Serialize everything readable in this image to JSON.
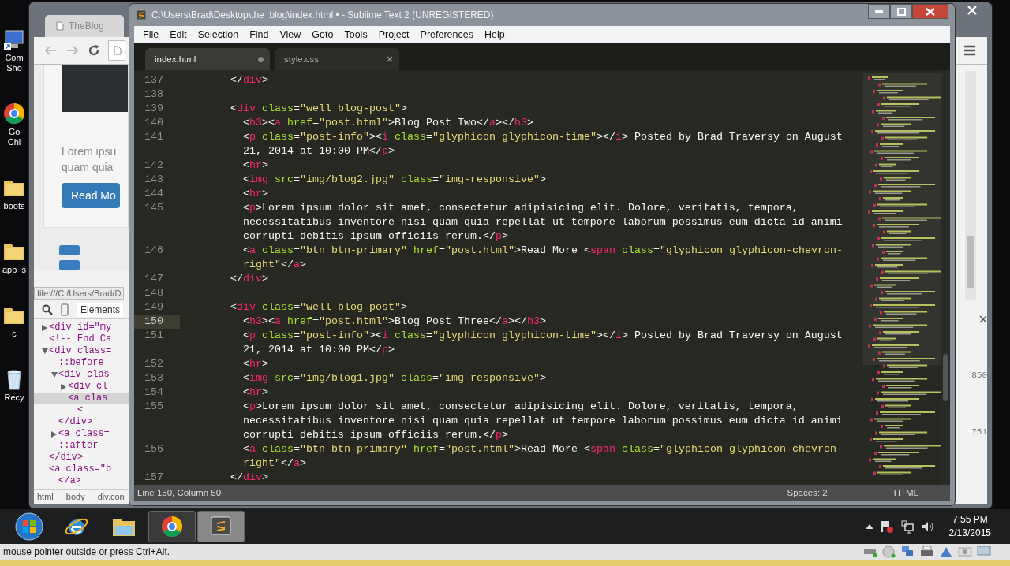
{
  "desktop_icons": [
    {
      "kind": "computer",
      "label": "Com Sho"
    },
    {
      "kind": "chrome",
      "label": "Go Chi"
    },
    {
      "kind": "folder",
      "label": "boots"
    },
    {
      "kind": "folder",
      "label": "app_s"
    },
    {
      "kind": "folder",
      "label": "c"
    },
    {
      "kind": "recycle",
      "label": "Recy"
    }
  ],
  "browser": {
    "tab": "TheBlog",
    "page": {
      "text_lines": [
        "Lorem ipsu",
        "quam quia"
      ],
      "button": "Read Mo"
    },
    "status_url": "file:///C:/Users/Brad/D",
    "devtools": {
      "tabs": [
        {
          "label": "Elements",
          "selected": true
        }
      ],
      "tree": [
        {
          "text": "<div id=\"my",
          "expanded": false,
          "selected": false
        },
        {
          "text": "<!-- End Ca",
          "selected": false
        },
        {
          "text": "<div class=",
          "expanded": true,
          "selected": false,
          "children": [
            {
              "text": "::before",
              "selected": false
            },
            {
              "text": "<div clas",
              "expanded": true,
              "selected": false,
              "children": [
                {
                  "text": "<div cl",
                  "expanded": false,
                  "selected": false
                },
                {
                  "text": "<a clas",
                  "selected": true,
                  "children": [
                    {
                      "text": "<",
                      "selected": false
                    }
                  ]
                }
              ]
            },
            {
              "text": "</div>",
              "selected": false
            },
            {
              "text": "<a class=",
              "expanded": false,
              "selected": false
            },
            {
              "text": "::after",
              "selected": false
            }
          ]
        },
        {
          "text": "</div>",
          "selected": false
        },
        {
          "text": "<a class=\"b",
          "selected": false,
          "children": [
            {
              "text": "</a>",
              "selected": false
            }
          ]
        }
      ],
      "breadcrumbs": [
        "html",
        "body",
        "div.con"
      ],
      "side_values": [
        "850",
        "751"
      ]
    }
  },
  "editor": {
    "title": "C:\\Users\\Brad\\Desktop\\the_blog\\index.html • - Sublime Text 2 (UNREGISTERED)",
    "menu": [
      "File",
      "Edit",
      "Selection",
      "Find",
      "View",
      "Goto",
      "Tools",
      "Project",
      "Preferences",
      "Help"
    ],
    "tabs": [
      {
        "label": "index.html",
        "selected": true,
        "modified": true
      },
      {
        "label": "style.css",
        "selected": false,
        "modified": false
      }
    ],
    "lines": [
      {
        "number": "137",
        "current": false,
        "tokens": [
          {
            "kind": "p",
            "text": "        </"
          },
          {
            "kind": "tag",
            "text": "div"
          },
          {
            "kind": "p",
            "text": ">"
          }
        ]
      },
      {
        "number": "138",
        "current": false
      },
      {
        "number": "139",
        "current": false,
        "tokens": [
          {
            "kind": "p",
            "text": "        <"
          },
          {
            "kind": "tag",
            "text": "div"
          },
          {
            "kind": "attr",
            "text": " class"
          },
          {
            "kind": "p",
            "text": "="
          },
          {
            "kind": "str",
            "text": "\"well blog-post\""
          },
          {
            "kind": "p",
            "text": ">"
          }
        ]
      },
      {
        "number": "140",
        "current": false,
        "tokens": [
          {
            "kind": "p",
            "text": "          <"
          },
          {
            "kind": "tag",
            "text": "h3"
          },
          {
            "kind": "p",
            "text": "><"
          },
          {
            "kind": "tag",
            "text": "a"
          },
          {
            "kind": "attr",
            "text": " href"
          },
          {
            "kind": "p",
            "text": "="
          },
          {
            "kind": "str",
            "text": "\"post.html\""
          },
          {
            "kind": "p",
            "text": ">"
          },
          {
            "kind": "text",
            "text": "Blog Post Two"
          },
          {
            "kind": "p",
            "text": "</"
          },
          {
            "kind": "tag",
            "text": "a"
          },
          {
            "kind": "p",
            "text": "></"
          },
          {
            "kind": "tag",
            "text": "h3"
          },
          {
            "kind": "p",
            "text": ">"
          }
        ]
      },
      {
        "number": "141",
        "current": false,
        "tokens": [
          {
            "kind": "p",
            "text": "          <"
          },
          {
            "kind": "tag",
            "text": "p"
          },
          {
            "kind": "attr",
            "text": " class"
          },
          {
            "kind": "p",
            "text": "="
          },
          {
            "kind": "str",
            "text": "\"post-info\""
          },
          {
            "kind": "p",
            "text": "><"
          },
          {
            "kind": "tag",
            "text": "i"
          },
          {
            "kind": "attr",
            "text": " class"
          },
          {
            "kind": "p",
            "text": "="
          },
          {
            "kind": "str",
            "text": "\"glyphicon glyphicon-time\""
          },
          {
            "kind": "p",
            "text": "></"
          },
          {
            "kind": "tag",
            "text": "i"
          },
          {
            "kind": "p",
            "text": ">"
          },
          {
            "kind": "text",
            "text": " Posted by Brad Traversy on August 21, 2014 at 10:00 PM"
          },
          {
            "kind": "p",
            "text": "</"
          },
          {
            "kind": "tag",
            "text": "p"
          },
          {
            "kind": "p",
            "text": ">"
          }
        ]
      },
      {
        "number": "142",
        "current": false,
        "tokens": [
          {
            "kind": "p",
            "text": "          <"
          },
          {
            "kind": "tag",
            "text": "hr"
          },
          {
            "kind": "p",
            "text": ">"
          }
        ]
      },
      {
        "number": "143",
        "current": false,
        "tokens": [
          {
            "kind": "p",
            "text": "          <"
          },
          {
            "kind": "tag",
            "text": "img"
          },
          {
            "kind": "attr",
            "text": " src"
          },
          {
            "kind": "p",
            "text": "="
          },
          {
            "kind": "str",
            "text": "\"img/blog2.jpg\""
          },
          {
            "kind": "attr",
            "text": " class"
          },
          {
            "kind": "p",
            "text": "="
          },
          {
            "kind": "str",
            "text": "\"img-responsive\""
          },
          {
            "kind": "p",
            "text": ">"
          }
        ]
      },
      {
        "number": "144",
        "current": false,
        "tokens": [
          {
            "kind": "p",
            "text": "          <"
          },
          {
            "kind": "tag",
            "text": "hr"
          },
          {
            "kind": "p",
            "text": ">"
          }
        ]
      },
      {
        "number": "145",
        "current": false,
        "tokens": [
          {
            "kind": "p",
            "text": "          <"
          },
          {
            "kind": "tag",
            "text": "p"
          },
          {
            "kind": "p",
            "text": ">"
          },
          {
            "kind": "text",
            "text": "Lorem ipsum dolor sit amet, consectetur adipisicing elit. Dolore, veritatis, tempora, necessitatibus inventore nisi quam quia repellat ut tempore laborum possimus eum dicta id animi corrupti debitis ipsum officiis rerum."
          },
          {
            "kind": "p",
            "text": "</"
          },
          {
            "kind": "tag",
            "text": "p"
          },
          {
            "kind": "p",
            "text": ">"
          }
        ]
      },
      {
        "number": "146",
        "current": false,
        "tokens": [
          {
            "kind": "p",
            "text": "          <"
          },
          {
            "kind": "tag",
            "text": "a"
          },
          {
            "kind": "attr",
            "text": " class"
          },
          {
            "kind": "p",
            "text": "="
          },
          {
            "kind": "str",
            "text": "\"btn btn-primary\""
          },
          {
            "kind": "attr",
            "text": " href"
          },
          {
            "kind": "p",
            "text": "="
          },
          {
            "kind": "str",
            "text": "\"post.html\""
          },
          {
            "kind": "p",
            "text": ">"
          },
          {
            "kind": "text",
            "text": "Read More "
          },
          {
            "kind": "p",
            "text": "<"
          },
          {
            "kind": "tag",
            "text": "span"
          },
          {
            "kind": "attr",
            "text": " class"
          },
          {
            "kind": "p",
            "text": "="
          },
          {
            "kind": "str",
            "text": "\"glyphicon glyphicon-chevron-right\""
          },
          {
            "kind": "p",
            "text": "</"
          },
          {
            "kind": "tag",
            "text": "a"
          },
          {
            "kind": "p",
            "text": ">"
          }
        ]
      },
      {
        "number": "147",
        "current": false,
        "tokens": [
          {
            "kind": "p",
            "text": "        </"
          },
          {
            "kind": "tag",
            "text": "div"
          },
          {
            "kind": "p",
            "text": ">"
          }
        ]
      },
      {
        "number": "148",
        "current": false
      },
      {
        "number": "149",
        "current": false,
        "tokens": [
          {
            "kind": "p",
            "text": "        <"
          },
          {
            "kind": "tag",
            "text": "div"
          },
          {
            "kind": "attr",
            "text": " class"
          },
          {
            "kind": "p",
            "text": "="
          },
          {
            "kind": "str",
            "text": "\"well blog-post\""
          },
          {
            "kind": "p",
            "text": ">"
          }
        ]
      },
      {
        "number": "150",
        "current": true,
        "tokens": [
          {
            "kind": "p",
            "text": "          <"
          },
          {
            "kind": "tag",
            "text": "h3"
          },
          {
            "kind": "p",
            "text": "><"
          },
          {
            "kind": "tag",
            "text": "a"
          },
          {
            "kind": "attr",
            "text": " href"
          },
          {
            "kind": "p",
            "text": "="
          },
          {
            "kind": "str",
            "text": "\"post.html\""
          },
          {
            "kind": "p",
            "text": ">"
          },
          {
            "kind": "text",
            "text": "Blog Post Three"
          },
          {
            "kind": "p",
            "text": "</"
          },
          {
            "kind": "tag",
            "text": "a"
          },
          {
            "kind": "p",
            "text": "></"
          },
          {
            "kind": "tag",
            "text": "h3"
          },
          {
            "kind": "p",
            "text": ">"
          }
        ]
      },
      {
        "number": "151",
        "current": false,
        "tokens": [
          {
            "kind": "p",
            "text": "          <"
          },
          {
            "kind": "tag",
            "text": "p"
          },
          {
            "kind": "attr",
            "text": " class"
          },
          {
            "kind": "p",
            "text": "="
          },
          {
            "kind": "str",
            "text": "\"post-info\""
          },
          {
            "kind": "p",
            "text": "><"
          },
          {
            "kind": "tag",
            "text": "i"
          },
          {
            "kind": "attr",
            "text": " class"
          },
          {
            "kind": "p",
            "text": "="
          },
          {
            "kind": "str",
            "text": "\"glyphicon glyphicon-time\""
          },
          {
            "kind": "p",
            "text": "></"
          },
          {
            "kind": "tag",
            "text": "i"
          },
          {
            "kind": "p",
            "text": ">"
          },
          {
            "kind": "text",
            "text": " Posted by Brad Traversy on August 21, 2014 at 10:00 PM"
          },
          {
            "kind": "p",
            "text": "</"
          },
          {
            "kind": "tag",
            "text": "p"
          },
          {
            "kind": "p",
            "text": ">"
          }
        ]
      },
      {
        "number": "152",
        "current": false,
        "tokens": [
          {
            "kind": "p",
            "text": "          <"
          },
          {
            "kind": "tag",
            "text": "hr"
          },
          {
            "kind": "p",
            "text": ">"
          }
        ]
      },
      {
        "number": "153",
        "current": false,
        "tokens": [
          {
            "kind": "p",
            "text": "          <"
          },
          {
            "kind": "tag",
            "text": "img"
          },
          {
            "kind": "attr",
            "text": " src"
          },
          {
            "kind": "p",
            "text": "="
          },
          {
            "kind": "str",
            "text": "\"img/blog1.jpg\""
          },
          {
            "kind": "attr",
            "text": " class"
          },
          {
            "kind": "p",
            "text": "="
          },
          {
            "kind": "str",
            "text": "\"img-responsive\""
          },
          {
            "kind": "p",
            "text": ">"
          }
        ]
      },
      {
        "number": "154",
        "current": false,
        "tokens": [
          {
            "kind": "p",
            "text": "          <"
          },
          {
            "kind": "tag",
            "text": "hr"
          },
          {
            "kind": "p",
            "text": ">"
          }
        ]
      },
      {
        "number": "155",
        "current": false,
        "tokens": [
          {
            "kind": "p",
            "text": "          <"
          },
          {
            "kind": "tag",
            "text": "p"
          },
          {
            "kind": "p",
            "text": ">"
          },
          {
            "kind": "text",
            "text": "Lorem ipsum dolor sit amet, consectetur adipisicing elit. Dolore, veritatis, tempora, necessitatibus inventore nisi quam quia repellat ut tempore laborum possimus eum dicta id animi corrupti debitis ipsum officiis rerum."
          },
          {
            "kind": "p",
            "text": "</"
          },
          {
            "kind": "tag",
            "text": "p"
          },
          {
            "kind": "p",
            "text": ">"
          }
        ]
      },
      {
        "number": "156",
        "current": false,
        "tokens": [
          {
            "kind": "p",
            "text": "          <"
          },
          {
            "kind": "tag",
            "text": "a"
          },
          {
            "kind": "attr",
            "text": " class"
          },
          {
            "kind": "p",
            "text": "="
          },
          {
            "kind": "str",
            "text": "\"btn btn-primary\""
          },
          {
            "kind": "attr",
            "text": " href"
          },
          {
            "kind": "p",
            "text": "="
          },
          {
            "kind": "str",
            "text": "\"post.html\""
          },
          {
            "kind": "p",
            "text": ">"
          },
          {
            "kind": "text",
            "text": "Read More "
          },
          {
            "kind": "p",
            "text": "<"
          },
          {
            "kind": "tag",
            "text": "span"
          },
          {
            "kind": "attr",
            "text": " class"
          },
          {
            "kind": "p",
            "text": "="
          },
          {
            "kind": "str",
            "text": "\"glyphicon glyphicon-chevron-right\""
          },
          {
            "kind": "p",
            "text": "</"
          },
          {
            "kind": "tag",
            "text": "a"
          },
          {
            "kind": "p",
            "text": ">"
          }
        ]
      },
      {
        "number": "157",
        "current": false,
        "tokens": [
          {
            "kind": "p",
            "text": "        </"
          },
          {
            "kind": "tag",
            "text": "div"
          },
          {
            "kind": "p",
            "text": ">"
          }
        ]
      }
    ],
    "status": {
      "position": "Line 150, Column 50",
      "indent": "Spaces: 2",
      "syntax": "HTML"
    }
  },
  "taskbar": {
    "apps": [
      {
        "kind": "start",
        "running": false,
        "active": false
      },
      {
        "kind": "ie",
        "running": false,
        "active": false
      },
      {
        "kind": "explorer",
        "running": false,
        "active": false
      },
      {
        "kind": "chrome",
        "running": true,
        "active": false
      },
      {
        "kind": "sublime",
        "running": true,
        "active": true
      }
    ],
    "clock": {
      "time": "7:55 PM",
      "date": "2/13/2015"
    }
  },
  "vm_status": "mouse pointer outside or press Ctrl+Alt."
}
